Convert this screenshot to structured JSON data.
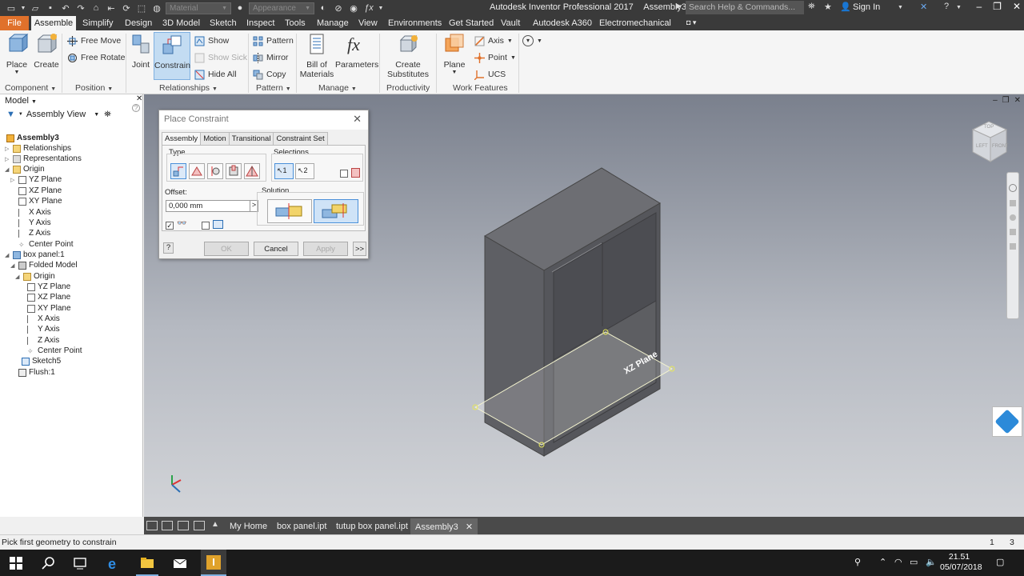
{
  "titlebar": {
    "material": "Material",
    "appearance": "Appearance",
    "app_name": "Autodesk Inventor Professional 2017",
    "doc_name": "Assembly3",
    "search_placeholder": "Search Help & Commands...",
    "sign_in": "Sign In"
  },
  "tabs": [
    "File",
    "Assemble",
    "Simplify",
    "Design",
    "3D Model",
    "Sketch",
    "Inspect",
    "Tools",
    "Manage",
    "View",
    "Environments",
    "Get Started",
    "Vault",
    "Autodesk A360",
    "Electromechanical"
  ],
  "ribbon": {
    "place": "Place",
    "create": "Create",
    "free_move": "Free Move",
    "free_rotate": "Free Rotate",
    "joint": "Joint",
    "constrain": "Constrain",
    "show": "Show",
    "show_sick": "Show Sick",
    "hide_all": "Hide All",
    "pattern": "Pattern",
    "mirror": "Mirror",
    "copy": "Copy",
    "bill_of_materials_1": "Bill of",
    "bill_of_materials_2": "Materials",
    "parameters": "Parameters",
    "create_substitutes_1": "Create",
    "create_substitutes_2": "Substitutes",
    "plane": "Plane",
    "axis": "Axis",
    "point": "Point",
    "ucs": "UCS",
    "groups": {
      "component": "Component",
      "position": "Position",
      "relationships": "Relationships",
      "pattern": "Pattern",
      "manage": "Manage",
      "productivity": "Productivity",
      "work_features": "Work Features"
    }
  },
  "browser": {
    "title": "Model",
    "view": "Assembly View",
    "items": [
      "Assembly3",
      "Relationships",
      "Representations",
      "Origin",
      "YZ Plane",
      "XZ Plane",
      "XY Plane",
      "X Axis",
      "Y Axis",
      "Z Axis",
      "Center Point",
      "box panel:1",
      "Folded Model",
      "Origin",
      "YZ Plane",
      "XZ Plane",
      "XY Plane",
      "X Axis",
      "Y Axis",
      "Z Axis",
      "Center Point",
      "Sketch5",
      "Flush:1"
    ]
  },
  "dialog": {
    "title": "Place Constraint",
    "tabs": [
      "Assembly",
      "Motion",
      "Transitional",
      "Constraint Set"
    ],
    "type_label": "Type",
    "selections_label": "Selections",
    "sel1": "1",
    "sel2": "2",
    "offset_label": "Offset:",
    "offset_value": "0,000 mm",
    "solution_label": "Solution",
    "ok": "OK",
    "cancel": "Cancel",
    "apply": "Apply",
    "more": ">>",
    "help": "?"
  },
  "viewport": {
    "plane_label": "XZ Plane",
    "viewcube_top": "TOP",
    "viewcube_left": "LEFT",
    "viewcube_front": "FRONT"
  },
  "doctabs": [
    "My Home",
    "box panel.ipt",
    "tutup box panel.ipt",
    "Assembly3"
  ],
  "status": {
    "message": "Pick first geometry to constrain",
    "num1": "1",
    "num2": "3"
  },
  "taskbar": {
    "time": "21.51",
    "date": "05/07/2018"
  },
  "colors": {
    "file_tab": "#e0712b",
    "titlebar": "#3a3a3a",
    "active_blue": "#c3dcf2"
  }
}
